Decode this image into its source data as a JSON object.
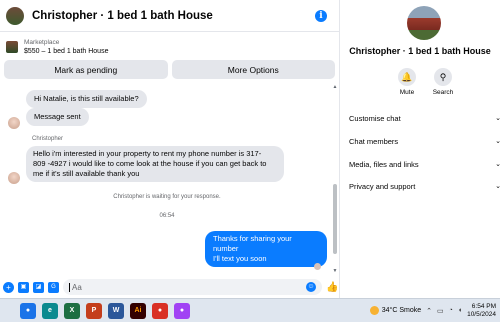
{
  "header": {
    "title": "Christopher · 1 bed 1 bath House",
    "info_icon": "info-icon"
  },
  "marketplace": {
    "label": "Marketplace",
    "item": "$550 – 1 bed 1 bath House"
  },
  "actions": {
    "pending": "Mark as pending",
    "more": "More Options"
  },
  "messages": {
    "m1": "Hi Natalie, is this still available?",
    "m2": "Message sent",
    "sender": "Christopher",
    "m3_l1": "Hello i'm interested in your property to rent my phone number is 317-",
    "m3_l2": "809 -4927 i would like to come look at the house if you can get back to",
    "m3_l3": "me if it's still available thank you",
    "waiting": "Christopher is waiting for your response.",
    "time": "06:54",
    "out_l1": "Thanks for sharing your number",
    "out_l2": "I'll text you soon"
  },
  "composer": {
    "placeholder": "Aa"
  },
  "profile": {
    "name": "Christopher · 1 bed 1 bath House",
    "mute": "Mute",
    "search": "Search",
    "menu": [
      "Customise chat",
      "Chat members",
      "Media, files and links",
      "Privacy and support"
    ]
  },
  "taskbar": {
    "apps": [
      "chrome",
      "edge",
      "excel",
      "powerpoint",
      "word",
      "illustrator",
      "chrome-profile-1",
      "chrome-profile-2"
    ],
    "weather": "34°C  Smoke",
    "time": "6:54 PM",
    "date": "10/5/2024"
  },
  "colors": {
    "accent": "#0a7cff",
    "bubble_in": "#e4e6eb"
  }
}
